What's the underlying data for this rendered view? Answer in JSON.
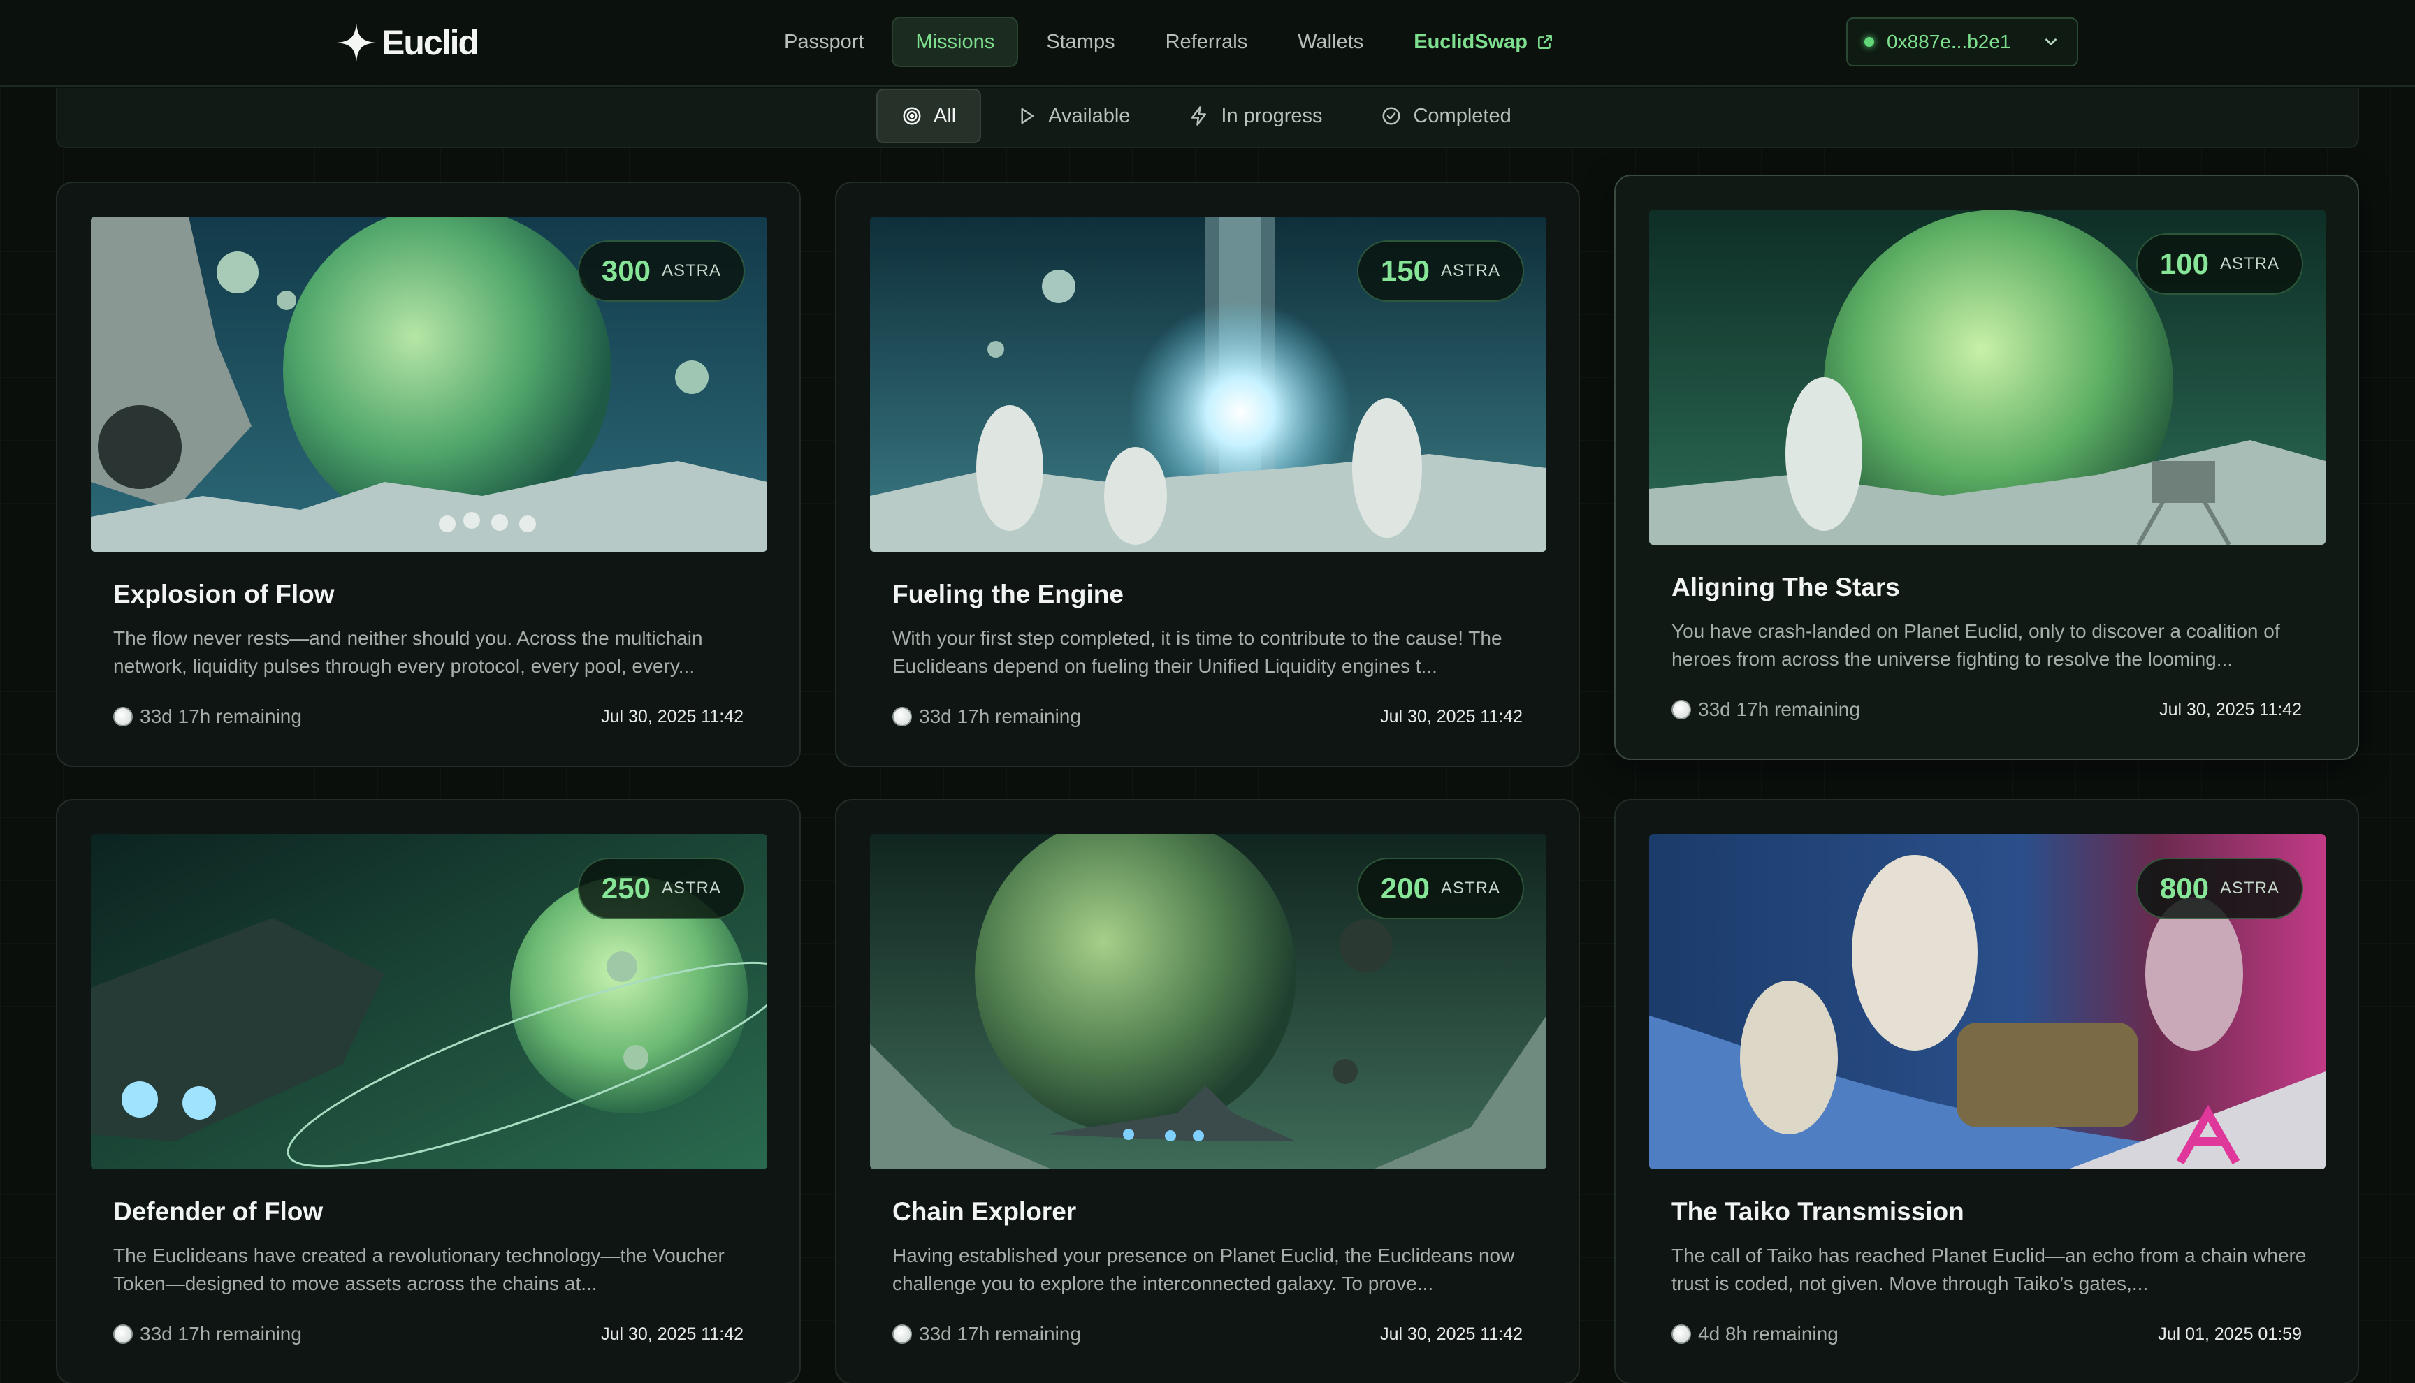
{
  "brand": {
    "name": "Euclid"
  },
  "nav": {
    "items": [
      {
        "label": "Passport",
        "active": false
      },
      {
        "label": "Missions",
        "active": true
      },
      {
        "label": "Stamps",
        "active": false
      },
      {
        "label": "Referrals",
        "active": false
      },
      {
        "label": "Wallets",
        "active": false
      }
    ],
    "swap_label": "EuclidSwap"
  },
  "wallet": {
    "address": "0x887e...b2e1"
  },
  "filters": [
    {
      "label": "All",
      "icon": "target-icon",
      "active": true
    },
    {
      "label": "Available",
      "icon": "play-icon",
      "active": false
    },
    {
      "label": "In progress",
      "icon": "lightning-icon",
      "active": false
    },
    {
      "label": "Completed",
      "icon": "check-circle-icon",
      "active": false
    }
  ],
  "missions": [
    {
      "title": "Explosion of Flow",
      "reward": "300",
      "unit": "ASTRA",
      "desc": "The flow never rests—and neither should you. Across the multichain network, liquidity pulses through every protocol, every pool, every...",
      "remaining": "33d 17h remaining",
      "date": "Jul 30, 2025 11:42"
    },
    {
      "title": "Fueling the Engine",
      "reward": "150",
      "unit": "ASTRA",
      "desc": "With your first step completed, it is time to contribute to the cause! The Euclideans depend on fueling their Unified Liquidity engines t...",
      "remaining": "33d 17h remaining",
      "date": "Jul 30, 2025 11:42"
    },
    {
      "title": "Aligning The Stars",
      "reward": "100",
      "unit": "ASTRA",
      "desc": "You have crash-landed on Planet Euclid, only to discover a coalition of heroes from across the universe fighting to resolve the looming...",
      "remaining": "33d 17h remaining",
      "date": "Jul 30, 2025 11:42"
    },
    {
      "title": "Defender of Flow",
      "reward": "250",
      "unit": "ASTRA",
      "desc": "The Euclideans have created a revolutionary technology—the Voucher Token—designed to move assets across the chains at...",
      "remaining": "33d 17h remaining",
      "date": "Jul 30, 2025 11:42"
    },
    {
      "title": "Chain Explorer",
      "reward": "200",
      "unit": "ASTRA",
      "desc": "Having established your presence on Planet Euclid, the Euclideans now challenge you to explore the interconnected galaxy. To prove...",
      "remaining": "33d 17h remaining",
      "date": "Jul 30, 2025 11:42"
    },
    {
      "title": "The Taiko Transmission",
      "reward": "800",
      "unit": "ASTRA",
      "desc": "The call of Taiko has reached Planet Euclid—an echo from a chain where trust is coded, not given. Move through Taiko’s gates,...",
      "remaining": "4d 8h remaining",
      "date": "Jul 01, 2025 01:59"
    }
  ]
}
